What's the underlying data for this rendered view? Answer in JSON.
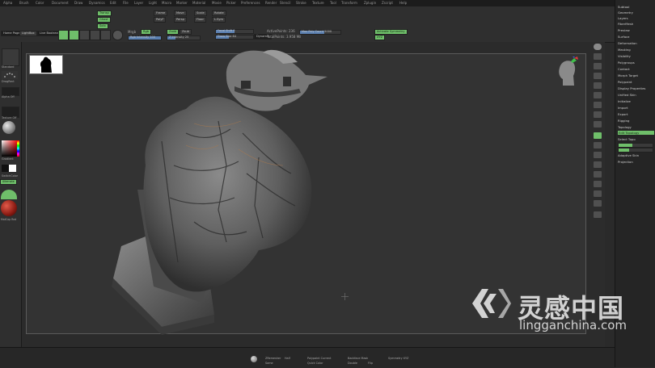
{
  "menu": {
    "items": [
      "Alpha",
      "Brush",
      "Color",
      "Document",
      "Draw",
      "Dynamics",
      "Edit",
      "File",
      "Layer",
      "Light",
      "Macro",
      "Marker",
      "Material",
      "Movie",
      "Picker",
      "Preferences",
      "Render",
      "Stencil",
      "Stroke",
      "Texture",
      "Tool",
      "Transform",
      "Zplugin",
      "Zscript",
      "Help"
    ]
  },
  "shelf": {
    "home_page": "Home Page",
    "lightbox": "LightBox",
    "live_boolean": "Live Boolean",
    "rgb_label": "Rgb",
    "rgb_intensity": "Rgb Intensity 100",
    "mrgb_label": "Mrgb",
    "zadd_label": "Zadd",
    "zsub_label": "Zsub",
    "zintensity": "Z Intensity 25",
    "focal_shift": "Focal Shift 0",
    "draw_size": "Draw Size 64",
    "dynamic": "Dynamic",
    "active_points": "ActivePoints: 236",
    "total_points": "TotalPoints: 3.958 Mil",
    "max_poly": "Max Poly Count 5000",
    "activate_symmetry": "Activate Symmetry",
    "transp": "Transp",
    "ghost": "Ghost",
    "solo": "Solo",
    "perspective": "Persp",
    "floor": "Floor",
    "lsym": "L.Sym",
    "xyz": "XYZ",
    "frame": "Frame",
    "move": "Move",
    "scale": "Scale",
    "rotate": "Rotate",
    "polyf": "PolyF"
  },
  "leftshelf": {
    "brush": "Standard",
    "stroke": "DragRect",
    "alpha": "Alpha Off",
    "texture": "Texture Off",
    "material": "MatCap Red",
    "gradient": "Gradient",
    "switch_color": "SwitchColor",
    "alternate": "Alternate"
  },
  "tray": {
    "items": [
      "Subtool",
      "Geometry",
      "Layers",
      "FiberMesh",
      "Preview",
      "Surface",
      "Deformation",
      "Masking",
      "Visibility",
      "Polygroups",
      "Contact",
      "Morph Target",
      "Polypaint",
      "Display Properties",
      "Unified Skin",
      "Initialize",
      "Import",
      "Export",
      "Rigging",
      "Topology",
      "Edit Topology",
      "Select Topo",
      "Adaptive Skin",
      "Projection"
    ],
    "highlighted": "Edit Topology"
  },
  "bottom": {
    "labels": [
      "ZRemesher",
      "Half",
      "Same",
      "Polypaint Current",
      "Quick Color",
      "Backface Mask",
      "Double",
      "Flip",
      "Symmetry XYZ"
    ]
  },
  "watermark": {
    "chinese": "灵感中国",
    "url": "lingganchina.com"
  },
  "colors": {
    "accent": "#6fbf6a",
    "canvas": "#2b2b2b",
    "panel": "#2f2f2f"
  }
}
